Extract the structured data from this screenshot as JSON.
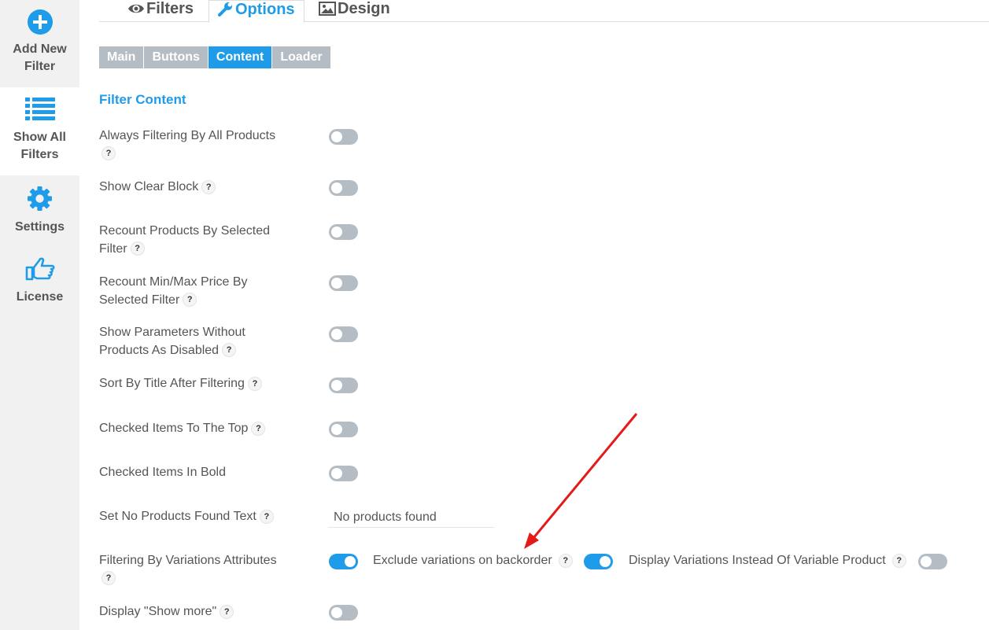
{
  "sidebar": {
    "items": [
      {
        "label_line1": "Add New",
        "label_line2": "Filter",
        "icon": "plus-circle-icon"
      },
      {
        "label_line1": "Show All",
        "label_line2": "Filters",
        "icon": "list-icon"
      },
      {
        "label_line1": "Settings",
        "icon": "gear-icon"
      },
      {
        "label_line1": "License",
        "icon": "thumbs-up-icon"
      }
    ]
  },
  "tabs": [
    {
      "label": "Filters",
      "icon": "eye-icon"
    },
    {
      "label": "Options",
      "icon": "wrench-icon",
      "active": true
    },
    {
      "label": "Design",
      "icon": "image-icon"
    }
  ],
  "subtabs": [
    {
      "label": "Main"
    },
    {
      "label": "Buttons"
    },
    {
      "label": "Content",
      "active": true
    },
    {
      "label": "Loader"
    }
  ],
  "section_title": "Filter Content",
  "help_glyph": "?",
  "options": [
    {
      "label": "Always Filtering By All Products",
      "on": false
    },
    {
      "label": "Show Clear Block",
      "on": false
    },
    {
      "label": "Recount Products By Selected Filter",
      "on": false
    },
    {
      "label": "Recount Min/Max Price By Selected Filter",
      "on": false
    },
    {
      "label": "Show Parameters Without Products As Disabled",
      "on": false
    },
    {
      "label": "Sort By Title After Filtering",
      "on": false
    },
    {
      "label": "Checked Items To The Top",
      "on": false
    },
    {
      "label": "Checked Items In Bold",
      "on": false
    },
    {
      "label": "Set No Products Found Text",
      "value": "No products found"
    },
    {
      "label": "Filtering By Variations Attributes",
      "on": true
    },
    {
      "label": "Display \"Show more\"",
      "on": false
    }
  ],
  "variation_options": [
    {
      "label": "Exclude variations on backorder",
      "on": true
    },
    {
      "label": "Display Variations Instead Of Variable Product",
      "on": false
    }
  ],
  "colors": {
    "accent": "#1e9be9",
    "toggle_off": "#b4bdc3",
    "sidebar_bg": "#f1f1f1",
    "arrow": "#e61919"
  }
}
